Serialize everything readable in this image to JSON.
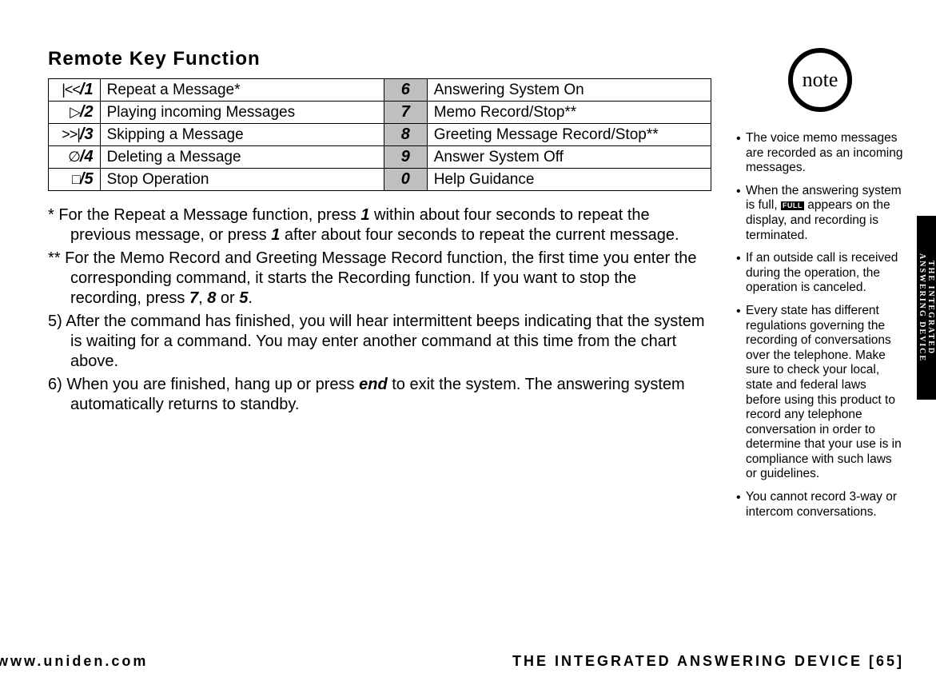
{
  "section_title": "Remote Key Function",
  "table": {
    "rows": [
      {
        "sym": "|<<",
        "key": "/1",
        "desc1": "Repeat a Message*",
        "num": "6",
        "desc2": "Answering System On"
      },
      {
        "sym": "▷",
        "key": "/2",
        "desc1": "Playing incoming Messages",
        "num": "7",
        "desc2": "Memo Record/Stop**"
      },
      {
        "sym": ">>|",
        "key": "/3",
        "desc1": "Skipping a Message",
        "num": "8",
        "desc2": "Greeting Message Record/Stop**"
      },
      {
        "sym": "∅",
        "key": "/4",
        "desc1": "Deleting a Message",
        "num": "9",
        "desc2": "Answer System Off"
      },
      {
        "sym": "□",
        "key": "/5",
        "desc1": "Stop Operation",
        "num": "0",
        "desc2": "Help Guidance"
      }
    ]
  },
  "notes": {
    "n1_pre": "*  For the Repeat a Message function, press ",
    "n1_k1": "1",
    "n1_mid": " within about four seconds to repeat the previous message, or press ",
    "n1_k2": "1",
    "n1_post": " after about four seconds to repeat the current message.",
    "n2_pre": "** For the Memo Record and Greeting Message Record function, the first time you enter the corresponding command, it starts the Recording function. If you want to stop the recording, press ",
    "n2_k1": "7",
    "n2_c1": ", ",
    "n2_k2": "8",
    "n2_c2": " or ",
    "n2_k3": "5",
    "n2_post": ".",
    "n3": "5) After the command has finished, you will hear intermittent beeps indicating that the system is waiting for a command. You may enter another command at this time from the chart above.",
    "n4_pre": "6) When you are finished, hang up or press ",
    "n4_k": "end",
    "n4_post": " to exit the system. The answering system automatically returns to standby."
  },
  "note_label": "note",
  "side": {
    "s1": "The voice memo messages are recorded as an incoming messages.",
    "s2_pre": "When the answering system is full, ",
    "s2_icon": "FULL",
    "s2_post": " appears on the display, and recording is terminated.",
    "s3": "If an outside call is received during the operation, the operation is canceled.",
    "s4": "Every state has different regulations governing the recording of conversations over the telephone. Make sure to check your local, state and federal laws before using this product to record any telephone conversation in order to determine that your use is in compliance with such laws or guidelines.",
    "s5": "You cannot record 3-way or intercom conversations."
  },
  "edge": {
    "line1": "THE INTEGRATED",
    "line2": "ANSWERING DEVICE"
  },
  "footer": {
    "url": "www.uniden.com",
    "title": "THE INTEGRATED ANSWERING DEVICE [65]"
  }
}
